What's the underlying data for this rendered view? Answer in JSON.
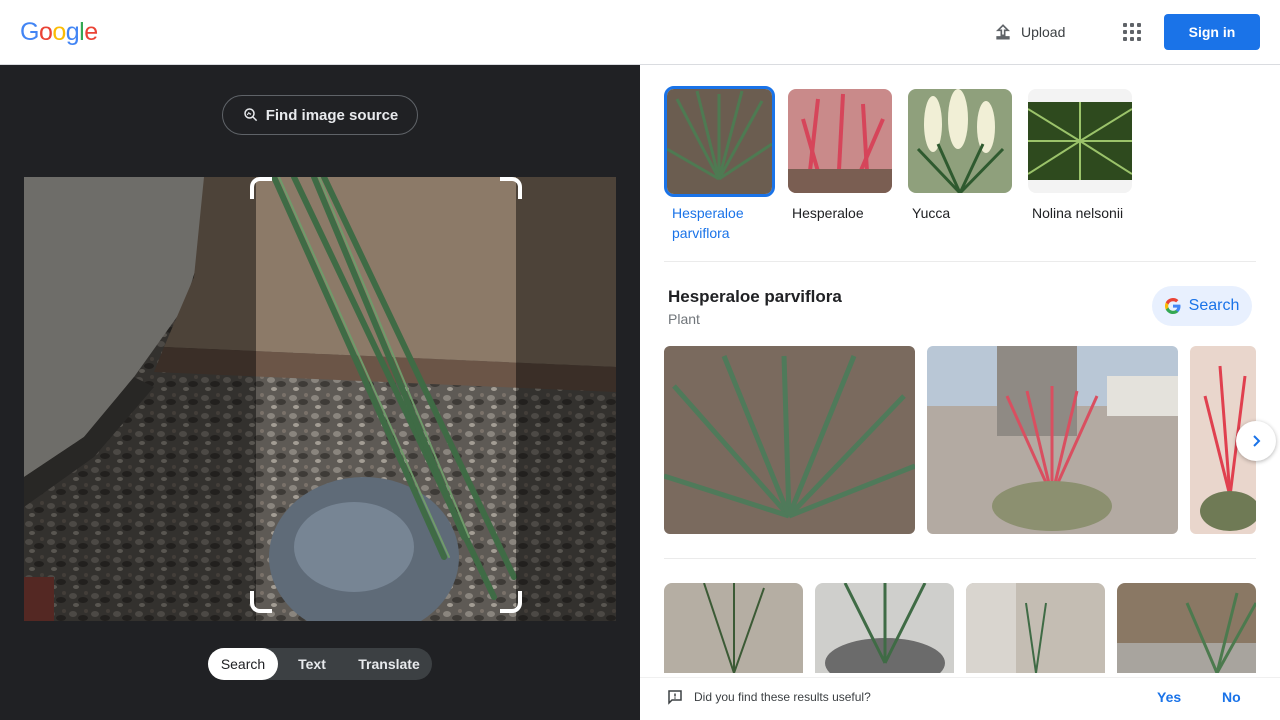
{
  "header": {
    "logo_letters": [
      "G",
      "o",
      "o",
      "g",
      "l",
      "e"
    ],
    "upload_label": "Upload",
    "signin_label": "Sign in"
  },
  "left": {
    "find_source_label": "Find image source",
    "modes": [
      "Search",
      "Text",
      "Translate"
    ],
    "active_mode": "Search"
  },
  "right": {
    "chips": [
      {
        "label": "Hesperaloe parviflora",
        "selected": true
      },
      {
        "label": "Hesperaloe",
        "selected": false
      },
      {
        "label": "Yucca",
        "selected": false
      },
      {
        "label": "Nolina nelsonii",
        "selected": false
      }
    ],
    "entity": {
      "title": "Hesperaloe parviflora",
      "subtitle": "Plant",
      "search_label": "Search"
    },
    "feedback": {
      "question": "Did you find these results useful?",
      "yes": "Yes",
      "no": "No"
    }
  },
  "colors": {
    "accent": "#1a73e8",
    "dark_panel": "#202124",
    "google_blue": "#4285f4",
    "google_red": "#ea4335",
    "google_yellow": "#fbbc05",
    "google_green": "#34a853"
  }
}
